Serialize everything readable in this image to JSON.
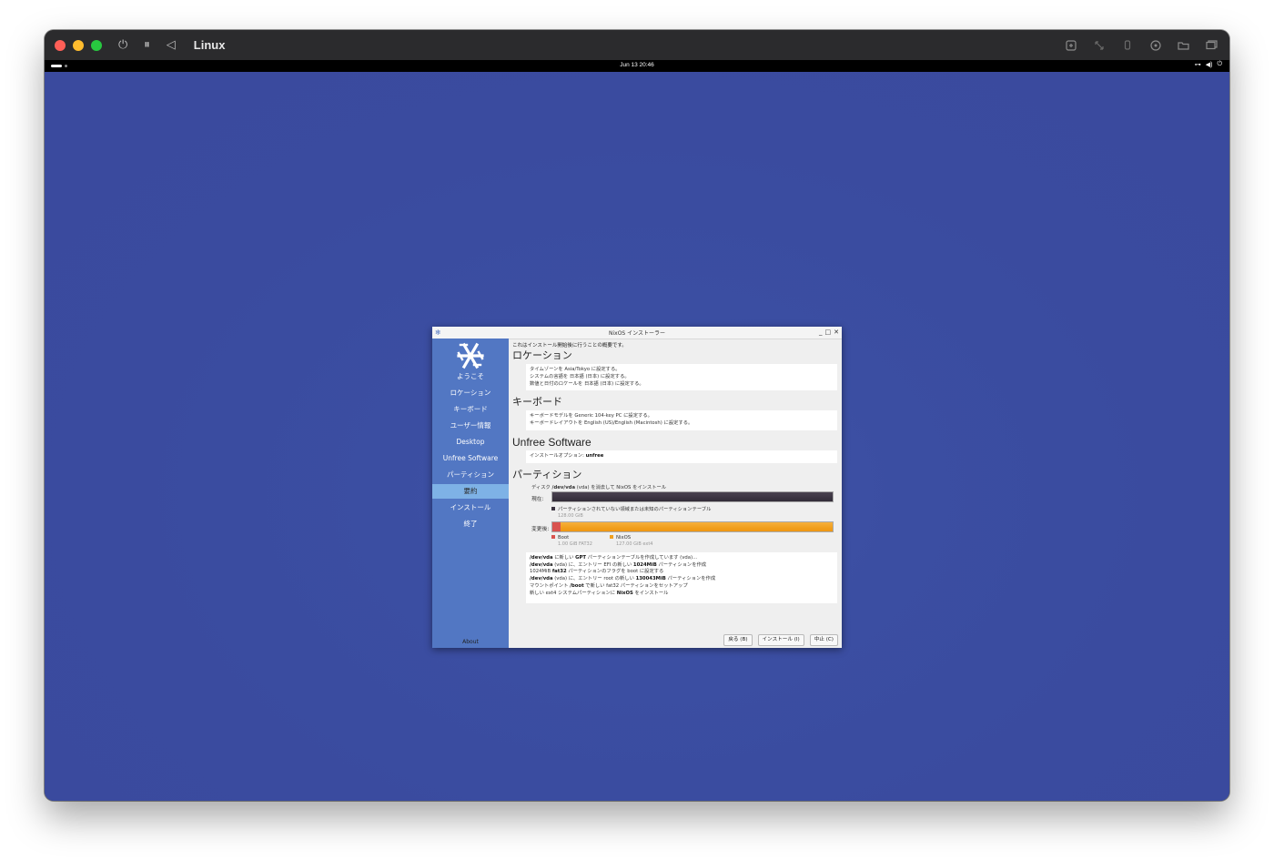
{
  "vm": {
    "title": "Linux",
    "controls": {
      "power": "⏻",
      "pause": "⏸",
      "back": "◁"
    },
    "toolbar_icons": [
      "screenshot-icon",
      "resize-icon",
      "usb-icon",
      "disk-icon",
      "folder-icon",
      "window-icon"
    ]
  },
  "guest_topbar": {
    "clock": "Jun 13  20:46",
    "tray": {
      "network": "⊶",
      "volume": "◀)",
      "power": "⏻"
    }
  },
  "installer": {
    "title": "NixOS インストーラー",
    "window_controls": {
      "minimize": "_",
      "maximize": "□",
      "close": "✕"
    },
    "sidebar": {
      "items": [
        {
          "label": "ようこそ"
        },
        {
          "label": "ロケーション"
        },
        {
          "label": "キーボード"
        },
        {
          "label": "ユーザー情報"
        },
        {
          "label": "Desktop"
        },
        {
          "label": "Unfree Software"
        },
        {
          "label": "パーティション"
        },
        {
          "label": "要約"
        },
        {
          "label": "インストール"
        },
        {
          "label": "終了"
        }
      ],
      "active_index": 7,
      "about": "About"
    },
    "summary": {
      "intro": "これはインストール開始後に行うことの概要です。",
      "location": {
        "heading": "ロケーション",
        "lines": [
          "タイムゾーンを Asia/Tokyo に設定する。",
          "システムの言語を 日本語 (日本) に設定する。",
          "数値と日付のロケールを 日本語 (日本) に設定する。"
        ]
      },
      "keyboard": {
        "heading": "キーボード",
        "lines": [
          "キーボードモデルを Generic 104-key PC に設定する。",
          "キーボードレイアウトを English (US)/English (Macintosh) に設定する。"
        ]
      },
      "unfree": {
        "heading": "Unfree Software",
        "label": "インストールオプション: ",
        "value": "unfree"
      },
      "partition": {
        "heading": "パーティション",
        "disk_prefix": "ディスク ",
        "disk_device": "/dev/vda",
        "disk_suffix": " (vda) を消去して NixOS をインストール",
        "current_label": "現在:",
        "current_legend": "パーティションされていない領域または未知のパーティションテーブル",
        "current_size": "128.00 GiB",
        "after_label": "変更後:",
        "boot_fraction": 0.008,
        "legend": [
          {
            "name": "Boot",
            "detail": "1.00 GiB  FAT32",
            "color": "#d9534f"
          },
          {
            "name": "NixOS",
            "detail": "127.00 GiB  ext4",
            "color": "#f0a020"
          }
        ],
        "operations": [
          {
            "b1": "/dev/vda",
            "t1": " に新しい ",
            "b2": "GPT",
            "t2": " パーティションテーブルを作成しています (vda)..."
          },
          {
            "b1": "/dev/vda",
            "t1": " (vda) に、エントリー EFI の新しい ",
            "b2": "1024MiB",
            "t2": " パーティションを作成"
          },
          {
            "b1": "",
            "t1": "1024MiB ",
            "b2": "fat32",
            "t2": " パーティションのフラグを boot に設定する"
          },
          {
            "b1": "/dev/vda",
            "t1": " (vda) に、エントリー root の新しい ",
            "b2": "130043MiB",
            "t2": " パーティションを作成"
          },
          {
            "b1": "",
            "t1": "マウントポイント ",
            "b2": "/boot",
            "t2": " で新しい fat32 パーティションをセットアップ"
          },
          {
            "b1": "",
            "t1": "新しい ext4 システムパーティションに ",
            "b2": "NixOS",
            "t2": " をインストール"
          }
        ]
      }
    },
    "buttons": {
      "back": "戻る (B)",
      "install": "インストール (I)",
      "cancel": "中止 (C)"
    }
  }
}
